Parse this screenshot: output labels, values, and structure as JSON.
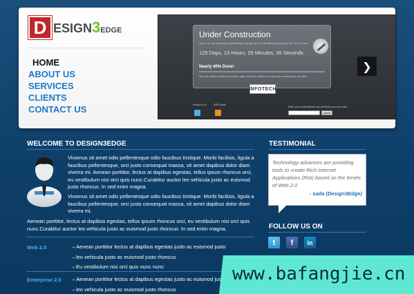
{
  "logo": {
    "letter": "D",
    "text_before": "ESIGN",
    "three": "3",
    "text_after": "EDGE"
  },
  "nav": {
    "items": [
      "HOME",
      "ABOUT US",
      "SERVICES",
      "CLIENTS",
      "CONTACT US"
    ],
    "active": "HOME"
  },
  "slider": {
    "title": "Under Construction",
    "subtitle": "Sorry, we are currently constructing a design of our website and we trust, the site is down.",
    "countdown": "125 Days, 13 Hours, 25 Minutes, 36 Seconds",
    "progress_label": "Nearly 40% Done!",
    "progress_value": 40,
    "note": "We have finished coding the services page, and have decided on a new logo necessary for the client.",
    "badge": "INFOTECH",
    "follow_label": "Follow us on",
    "rss_label": "RSS Feeds",
    "email_label": "Enter your email address and we'll keep you up to date.",
    "submit_label": "submit",
    "next_glyph": "❯"
  },
  "welcome": {
    "title": "WELCOME TO DESIGN3EDGE",
    "para1": "Vivamus sit amet odio pellentesque odio faucibus tristique. Morbi facilisis, ligula a faucibus pellentesque, orci justo consequat massa, sit amet dapibus dolor diam viverra mi. Aenean porttitor, lectus at dapibus egestas, tellus ipsum rhoncus orci, eu vestibulum nisi orci quis nunc.Curabitur auctor leo vehicula justo ac euismod justo rhoncus. In sed enim magna.",
    "para2": "Vivamus sit amet odio pellentesque odio faucibus tristique. Morbi facilisis, ligula a faucibus pellentesque, orci justo consequat massa, sit amet dapibus dolor diam viverra mi.",
    "para3": "Aenean porttitor, lectus at dapibus egestas, tellus ipsum rhoncus orci, eu vestibulum nisi orci quis nunc.Curabitur auctor leo vehicula justo ac euismod justo rhoncus. In sed enim magna."
  },
  "lists": [
    {
      "category": "Web 2.0",
      "items": [
        "Aenean porttitor lectus at dapibus egestas justo ac euismod justo",
        "leo vehicula justo ac euismod justo rhoncus",
        "Eu vestibulum nisi orci quis nunc nunc"
      ]
    },
    {
      "category": "Enterprise 2.0",
      "items": [
        "Aenean porttitor lectus at dapibus egestas justo ac euismod justo",
        "leo vehicula justo ac euismod justo rhoncus"
      ]
    }
  ],
  "testimonial": {
    "title": "TESTIMONIAL",
    "text": "Technology advances are providing tools to create Rich Internet Applications (RIA) based on the tenets of Web 2.0",
    "author": "- sada (Design3Edge)"
  },
  "follow": {
    "title": "FOLLOW US ON",
    "twitter": "t",
    "facebook": "f",
    "linkedin": "in"
  },
  "watermark": "www.bafangjie.cn",
  "colors": {
    "background": "#0e3f6a",
    "link_blue": "#1a7ac9",
    "logo_red": "#c0272d",
    "logo_green": "#7bbf2a",
    "category_blue": "#4bb0f0",
    "watermark_bg": "#5ee8d4"
  }
}
